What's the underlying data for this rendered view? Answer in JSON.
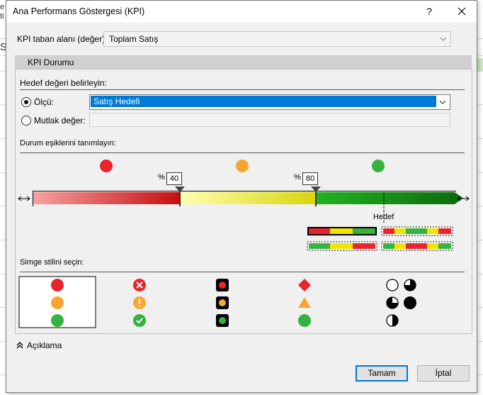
{
  "window": {
    "title": "Ana Performans Göstergesi (KPI)",
    "help_label": "?",
    "close_label": "✕"
  },
  "base_field": {
    "label": "KPI taban alanı (değer):",
    "value": "Toplam Satış"
  },
  "tab": {
    "label": "KPI Durumu"
  },
  "target": {
    "section_label": "Hedef değeri belirleyin:",
    "measure_label": "Ölçü:",
    "measure_value": "Satış Hedefi",
    "measure_selected": true,
    "absolute_label": "Mutlak değer:",
    "absolute_value": ""
  },
  "thresholds": {
    "section_label": "Durum eşiklerini tanımlayın:",
    "low_value": "40",
    "high_value": "80",
    "percent_symbol": "%",
    "target_marker_label": "Hedef",
    "status_colors": {
      "red": "#e8252b",
      "orange": "#f8a631",
      "green": "#36b23f"
    }
  },
  "icon_style": {
    "section_label": "Simge stilini seçin:"
  },
  "description_toggle": {
    "label": "Açıklama"
  },
  "buttons": {
    "ok": "Tamam",
    "cancel": "İptal"
  }
}
